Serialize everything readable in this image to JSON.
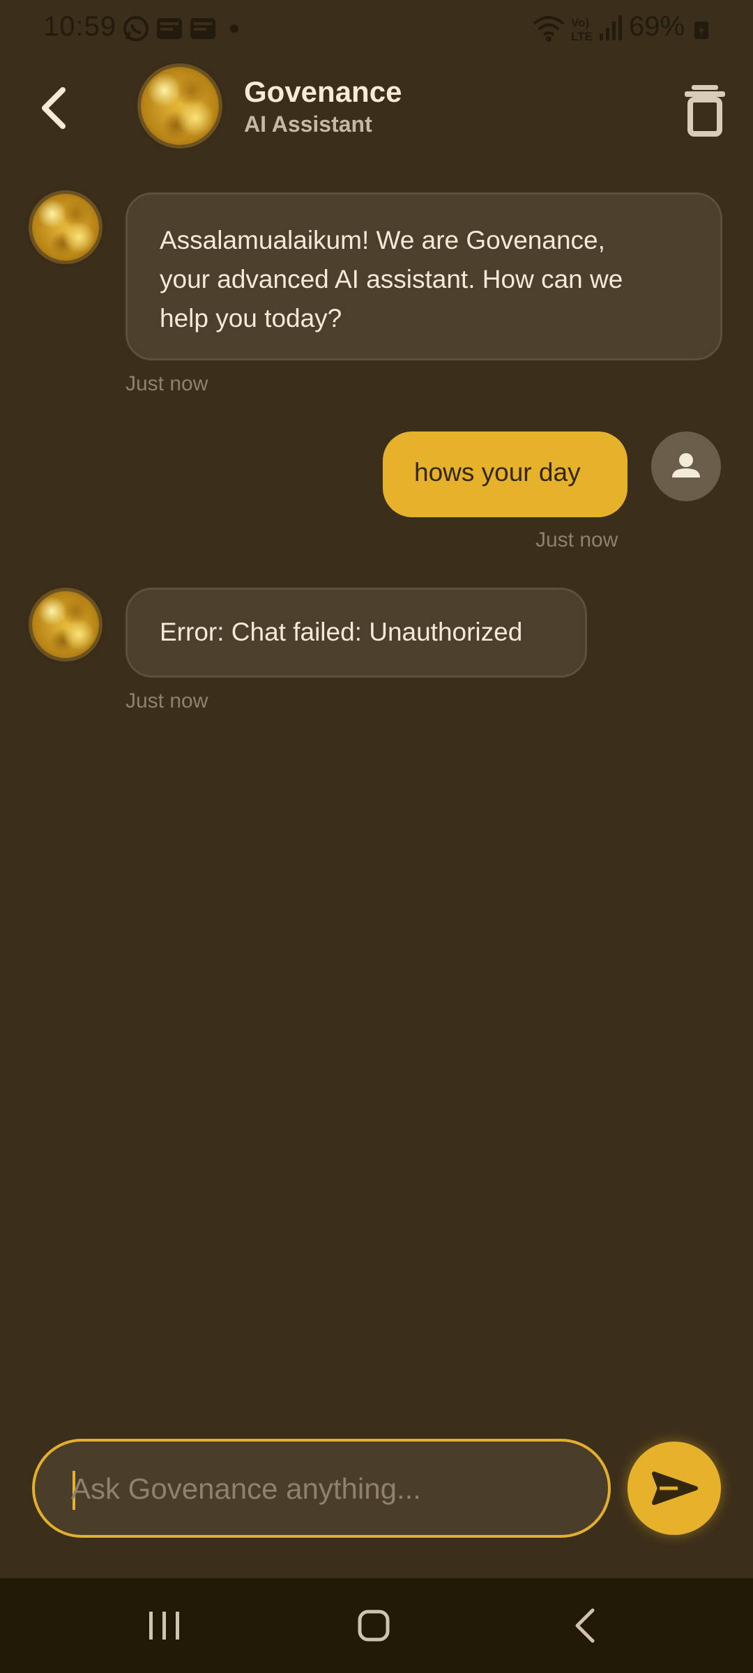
{
  "status_bar": {
    "time": "10:59",
    "battery_percent": "69%",
    "icons": [
      "whatsapp-icon",
      "news-icon",
      "news-icon",
      "dot-icon",
      "wifi-icon",
      "volte-icon",
      "signal-icon",
      "battery-charging-icon"
    ]
  },
  "header": {
    "title": "Govenance",
    "subtitle": "AI Assistant",
    "icons": [
      "back-arrow-icon",
      "gold-avatar",
      "trash-icon"
    ]
  },
  "messages": [
    {
      "sender": "bot",
      "lines": [
        "Assalamualaikum! We are Govenance,",
        "your advanced AI assistant. How can we",
        "help you today?"
      ],
      "time": "Just now"
    },
    {
      "sender": "user",
      "text": "hows your day",
      "time": "Just now"
    },
    {
      "sender": "bot",
      "text": "Error: Chat failed: Unauthorized",
      "time": "Just now"
    }
  ],
  "input": {
    "value": "",
    "placeholder": "Ask Govenance anything..."
  },
  "nav": {
    "icons": [
      "recent-apps-icon",
      "home-icon",
      "nav-back-icon"
    ]
  },
  "colors": {
    "background": "#3b2e1a",
    "accent": "#e6b22b",
    "bot_bubble": "#4c3f2c",
    "nav_bar": "#221806",
    "timestamp": "#8f826d"
  }
}
